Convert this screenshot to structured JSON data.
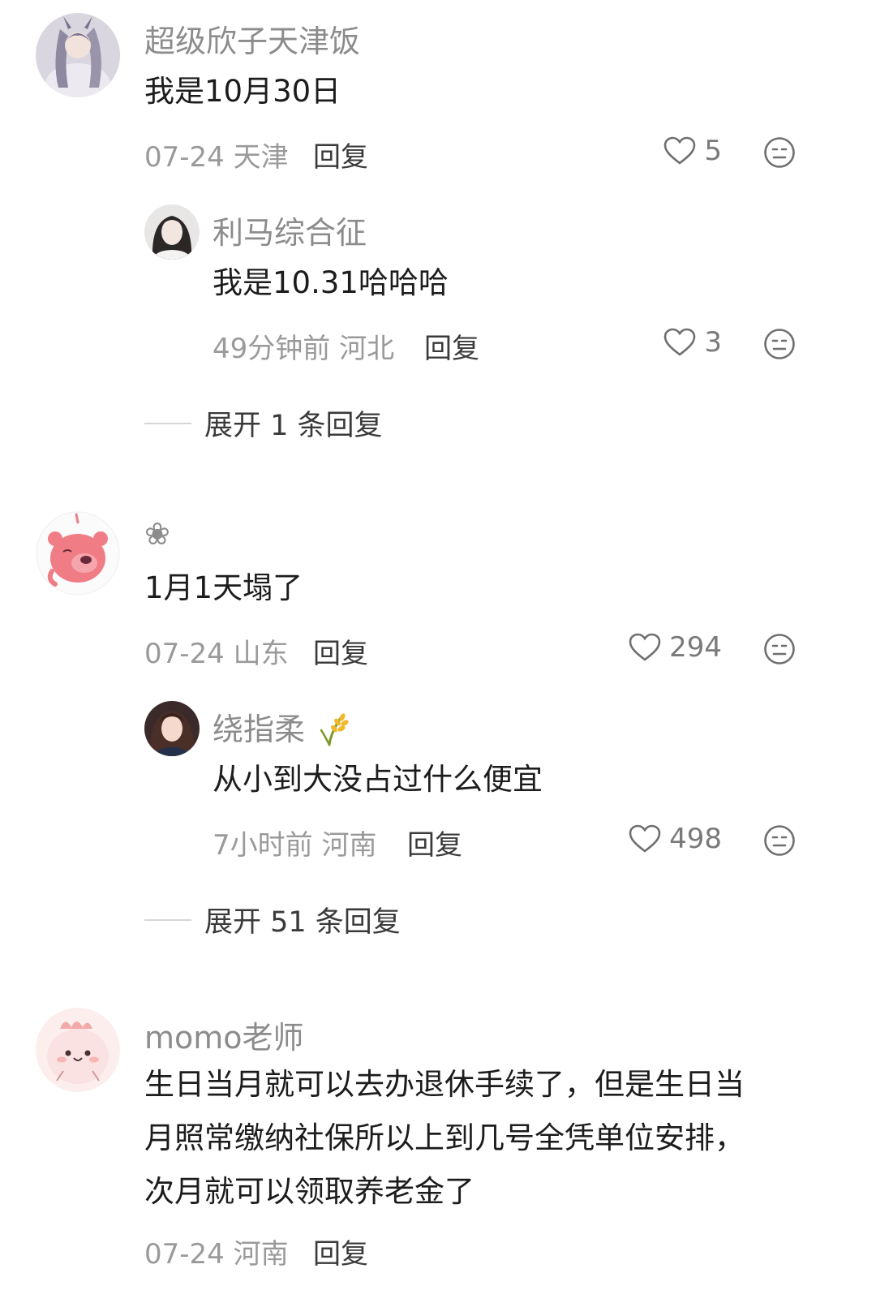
{
  "comments": [
    {
      "username": "超级欣子天津饭",
      "text": "我是10月30日",
      "meta": "07-24 天津",
      "reply_label": "回复",
      "likes": "5",
      "replies": [
        {
          "username": "利马综合征",
          "text": "我是10.31哈哈哈",
          "meta": "49分钟前 河北",
          "reply_label": "回复",
          "likes": "3"
        }
      ],
      "expand_label": "展开 1 条回复"
    },
    {
      "username": "❀",
      "text": "1月1天塌了",
      "meta": "07-24 山东",
      "reply_label": "回复",
      "likes": "294",
      "replies": [
        {
          "username": "绕指柔",
          "username_emoji": "rice-icon",
          "text": "从小到大没占过什么便宜",
          "meta": "7小时前 河南",
          "reply_label": "回复",
          "likes": "498"
        }
      ],
      "expand_label": "展开 51 条回复"
    },
    {
      "username": "momo老师",
      "text_lines": [
        "生日当月就可以去办退休手续了，但是生日当",
        "月照常缴纳社保所以上到几号全凭单位安排，",
        "次月就可以领取养老金了"
      ],
      "meta": "07-24 河南",
      "reply_label": "回复"
    }
  ],
  "colors": {
    "username": "#8c8c8c",
    "text": "#1c1c1c",
    "meta": "#9a9a9a",
    "action": "#3a3a3a"
  },
  "icons": {
    "like": "heart-outline-icon",
    "dislike": "neutral-face-icon"
  }
}
